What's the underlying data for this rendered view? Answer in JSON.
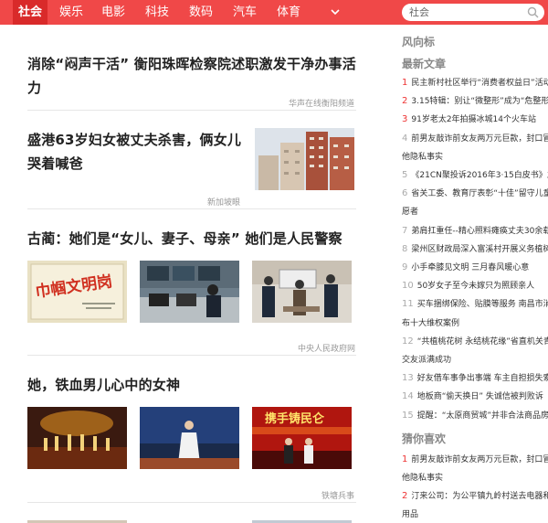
{
  "nav": {
    "items": [
      "社会",
      "娱乐",
      "电影",
      "科技",
      "数码",
      "汽车",
      "体育"
    ],
    "active": "社会",
    "search_value": "社会"
  },
  "feed": [
    {
      "title": "消除“闷声干活” 衡阳珠晖检察院述职激发干净办事活力",
      "source": "华声在线衡阳频道"
    },
    {
      "title_line1": "盛港63岁妇女被丈夫杀害，俩女儿",
      "title_line2": "哭着喊爸",
      "source": "新加坡眼"
    },
    {
      "title": "古蔺：她们是“女儿、妻子、母亲” 她们是人民警察",
      "source": "中央人民政府网",
      "image1_text": "巾帼文明岗"
    },
    {
      "title": "她，铁血男儿心中的女神",
      "source": "铁塘兵事",
      "image3_text": "携手铸民仑"
    }
  ],
  "sidebar": {
    "header": "风向标",
    "latest_header": "最新文章",
    "latest": [
      {
        "num": "1",
        "text": "民主新村社区举行“消费者权益日”活动"
      },
      {
        "num": "2",
        "text": "3.15特辑：别让“微整形”成为“危整形”"
      },
      {
        "num": "3",
        "text": "91岁老太2年拍摄冰城14个火车站"
      },
      {
        "num": "4",
        "text": "前男友敲诈前女友两万元巨款，封口冒"
      },
      {
        "num": "",
        "text": "他隐私事实"
      },
      {
        "num": "5",
        "text": "《21CN聚投诉2016年3·15白皮书》之"
      },
      {
        "num": "6",
        "text": "省关工委、教育厅表彰“十佳”留守儿童"
      },
      {
        "num": "",
        "text": "愿者"
      },
      {
        "num": "7",
        "text": "弟肩扛重任--精心照料瘫痪丈夫30余载"
      },
      {
        "num": "8",
        "text": "梁州区财政局深入富溪村开展义务植树"
      },
      {
        "num": "9",
        "text": "小手牵膝见文明 三月春风暖心意"
      },
      {
        "num": "10",
        "text": "50岁女子至今未嫁只为照顾亲人"
      },
      {
        "num": "11",
        "text": "买车捆绑保险、贴膜等服务 南昌市消"
      },
      {
        "num": "",
        "text": "布十大维权案例"
      },
      {
        "num": "12",
        "text": "“共植桃花树 永结桃花缘”省直机关青年"
      },
      {
        "num": "",
        "text": "交友派满成功"
      },
      {
        "num": "13",
        "text": "好友借车事争出事端 车主自担损失索"
      },
      {
        "num": "14",
        "text": "地板商“偷天换日” 失诚信被判败诉"
      },
      {
        "num": "15",
        "text": "提醒：“太原商贸城”并非合法商品房交"
      }
    ],
    "guess_header": "猜你喜欢",
    "guess": [
      {
        "num": "1",
        "text": "前男友敲诈前女友两万元巨款，封口冒"
      },
      {
        "num": "",
        "text": "他隐私事实"
      },
      {
        "num": "2",
        "text": "汀来公司：为公平镇九岭村送去电器和"
      },
      {
        "num": "",
        "text": "用品"
      },
      {
        "num": "3",
        "text": "长春大米在上海落地生根 以多种形式赞"
      }
    ]
  }
}
